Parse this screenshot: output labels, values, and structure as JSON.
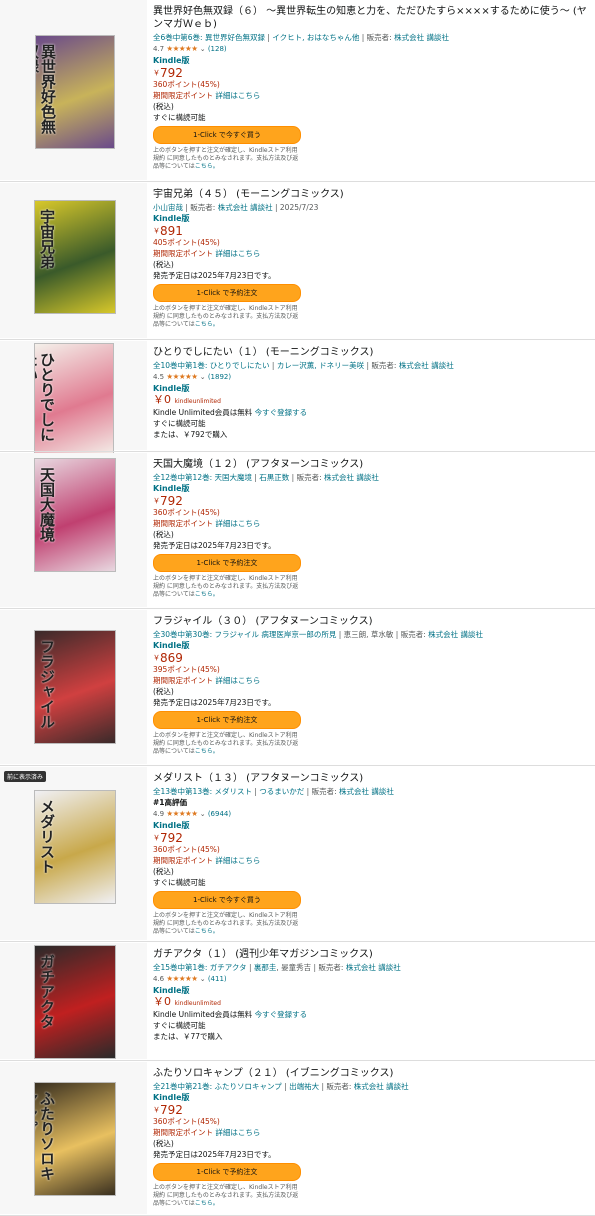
{
  "items": [
    {
      "title": "異世界好色無双録（６） 〜異世界転生の知恵と力を、ただひたすら××××するために使う〜 (ヤンマガＷｅｂ)",
      "byline": [
        {
          "t": "全6巻中第6巻: 異世界好色無双録",
          "link": true
        },
        {
          "t": " | ",
          "link": false
        },
        {
          "t": "イクヒト, おはなちゃん他",
          "link": true
        },
        {
          "t": " | 販売者: ",
          "link": false
        },
        {
          "t": "株式会社 講談社",
          "link": true
        }
      ],
      "rating": "4.7",
      "stars": "★★★★★",
      "count": "(128)",
      "format": "Kindle版",
      "price": "792",
      "yen": "￥",
      "points": "360ポイント(45%)",
      "limited": "期間限定ポイント",
      "limited_link": "詳細はこちら",
      "tax": "(税込)",
      "status": "すぐに構読可能",
      "button": "1-Click で今すぐ買う",
      "note": "上のボタンを押すと注文が確定し、Kindleストア利用規約 に同意したものとみなされます。支払方法及び返品等については",
      "note_link": "こちら。",
      "cover": {
        "bg": "#6a4a8a",
        "accent": "#c8b35a",
        "text": "異世界好色無双録"
      }
    },
    {
      "title": "宇宙兄弟（４５） (モーニングコミックス)",
      "byline": [
        {
          "t": "小山宙哉",
          "link": true
        },
        {
          "t": " | 販売者: ",
          "link": false
        },
        {
          "t": "株式会社 講談社",
          "link": true
        },
        {
          "t": " | 2025/7/23",
          "link": false
        }
      ],
      "format": "Kindle版",
      "price": "891",
      "yen": "￥",
      "points": "405ポイント(45%)",
      "limited": "期間限定ポイント",
      "limited_link": "詳細はこちら",
      "tax": "(税込)",
      "release": "発売予定日は2025年7月23日です。",
      "button": "1-Click で予約注文",
      "note": "上のボタンを押すと注文が確定し、Kindleストア利用規約 に同意したものとみなされます。支払方法及び返品等については",
      "note_link": "こちら。",
      "cover": {
        "bg": "#d8c82a",
        "accent": "#3a5a2a",
        "text": "宇宙兄弟"
      }
    },
    {
      "title": "ひとりでしにたい（１） (モーニングコミックス)",
      "byline": [
        {
          "t": "全10巻中第1巻: ひとりでしにたい",
          "link": true
        },
        {
          "t": " | ",
          "link": false
        },
        {
          "t": "カレー沢薫, ドネリー美咲",
          "link": true
        },
        {
          "t": " | 販売者: ",
          "link": false
        },
        {
          "t": "株式会社 講談社",
          "link": true
        }
      ],
      "rating": "4.5",
      "stars": "★★★★★",
      "count": "(1892)",
      "format": "Kindle版",
      "price": "0",
      "yen": "￥",
      "ku_logo": "kindleunlimited",
      "ku_text": "Kindle Unlimited会員は無料",
      "ku_link": "今すぐ登録する",
      "status": "すぐに構読可能",
      "or": "または、￥792で購入",
      "cover": {
        "bg": "#f4f0ea",
        "accent": "#e07a90",
        "text": "ひとりでしにたい"
      }
    },
    {
      "title": "天国大魔境（１２） (アフタヌーンコミックス)",
      "byline": [
        {
          "t": "全12巻中第12巻: 天国大魔境",
          "link": true
        },
        {
          "t": " | ",
          "link": false
        },
        {
          "t": "石黒正数",
          "link": true
        },
        {
          "t": " | 販売者: ",
          "link": false
        },
        {
          "t": "株式会社 講談社",
          "link": true
        }
      ],
      "format": "Kindle版",
      "price": "792",
      "yen": "￥",
      "points": "360ポイント(45%)",
      "limited": "期間限定ポイント",
      "limited_link": "詳細はこちら",
      "tax": "(税込)",
      "release": "発売予定日は2025年7月23日です。",
      "button": "1-Click で予約注文",
      "note": "上のボタンを押すと注文が確定し、Kindleストア利用規約 に同意したものとみなされます。支払方法及び返品等については",
      "note_link": "こちら。",
      "cover": {
        "bg": "#e8d8e0",
        "accent": "#c04070",
        "text": "天国大魔境"
      }
    },
    {
      "title": "フラジャイル（３０） (アフタヌーンコミックス)",
      "byline": [
        {
          "t": "全30巻中第30巻: フラジャイル 病理医岸京一郎の所見",
          "link": true
        },
        {
          "t": " | 恵三朗, 草水敏 | 販売者: ",
          "link": false
        },
        {
          "t": "株式会社 講談社",
          "link": true
        }
      ],
      "format": "Kindle版",
      "price": "869",
      "yen": "￥",
      "points": "395ポイント(45%)",
      "limited": "期間限定ポイント",
      "limited_link": "詳細はこちら",
      "tax": "(税込)",
      "release": "発売予定日は2025年7月23日です。",
      "button": "1-Click で予約注文",
      "note": "上のボタンを押すと注文が確定し、Kindleストア利用規約 に同意したものとみなされます。支払方法及び返品等については",
      "note_link": "こちら。",
      "cover": {
        "bg": "#3a2a2a",
        "accent": "#d04040",
        "text": "フラジャイル"
      }
    },
    {
      "badge": "前に表示済み",
      "title": "メダリスト（１３） (アフタヌーンコミックス)",
      "byline": [
        {
          "t": "全13巻中第13巻: メダリスト",
          "link": true
        },
        {
          "t": " | ",
          "link": false
        },
        {
          "t": "つるまいかだ",
          "link": true
        },
        {
          "t": " | 販売者: ",
          "link": false
        },
        {
          "t": "株式会社 講談社",
          "link": true
        }
      ],
      "best": "#1高評価",
      "rating": "4.9",
      "stars": "★★★★★",
      "count": "(6944)",
      "format": "Kindle版",
      "price": "792",
      "yen": "￥",
      "points": "360ポイント(45%)",
      "limited": "期間限定ポイント",
      "limited_link": "詳細はこちら",
      "tax": "(税込)",
      "status": "すぐに構読可能",
      "button": "1-Click で今すぐ買う",
      "note": "上のボタンを押すと注文が確定し、Kindleストア利用規約 に同意したものとみなされます。支払方法及び返品等については",
      "note_link": "こちら。",
      "cover": {
        "bg": "#f0f0f4",
        "accent": "#c8a84a",
        "text": "メダリスト"
      }
    },
    {
      "title": "ガチアクタ（１） (週刊少年マガジンコミックス)",
      "byline": [
        {
          "t": "全15巻中第1巻: ガチアクタ",
          "link": true
        },
        {
          "t": " | ",
          "link": false
        },
        {
          "t": "裏那圭",
          "link": true
        },
        {
          "t": ", 晏童秀吉 | 販売者: ",
          "link": false
        },
        {
          "t": "株式会社 講談社",
          "link": true
        }
      ],
      "rating": "4.6",
      "stars": "★★★★★",
      "count": "(411)",
      "format": "Kindle版",
      "price": "0",
      "yen": "￥",
      "ku_logo": "kindleunlimited",
      "ku_text": "Kindle Unlimited会員は無料",
      "ku_link": "今すぐ登録する",
      "status": "すぐに構読可能",
      "or": "または、￥77で購入",
      "cover": {
        "bg": "#2a2a2a",
        "accent": "#c02020",
        "text": "ガチアクタ"
      }
    },
    {
      "title": "ふたりソロキャンプ（２１） (イブニングコミックス)",
      "byline": [
        {
          "t": "全21巻中第21巻: ふたりソロキャンプ",
          "link": true
        },
        {
          "t": " | ",
          "link": false
        },
        {
          "t": "出端祐大",
          "link": true
        },
        {
          "t": " | 販売者: ",
          "link": false
        },
        {
          "t": "株式会社 講談社",
          "link": true
        }
      ],
      "format": "Kindle版",
      "price": "792",
      "yen": "￥",
      "points": "360ポイント(45%)",
      "limited": "期間限定ポイント",
      "limited_link": "詳細はこちら",
      "tax": "(税込)",
      "release": "発売予定日は2025年7月23日です。",
      "button": "1-Click で予約注文",
      "note": "上のボタンを押すと注文が確定し、Kindleストア利用規約 に同意したものとみなされます。支払方法及び返品等については",
      "note_link": "こちら。",
      "cover": {
        "bg": "#3a3020",
        "accent": "#e8c060",
        "text": "ふたりソロキャンプ"
      }
    }
  ]
}
